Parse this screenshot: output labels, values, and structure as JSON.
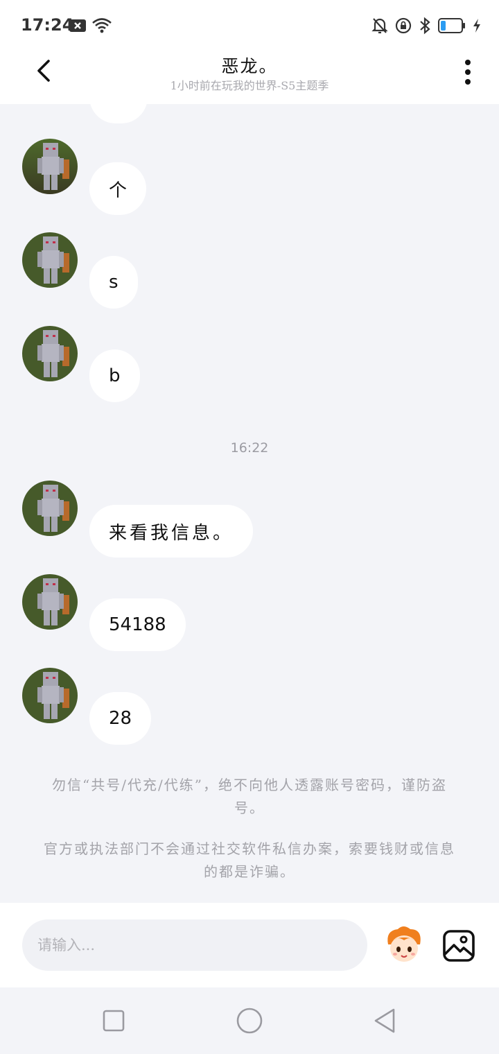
{
  "status_bar": {
    "time": "17:24",
    "left_icons": [
      "sim-x-icon",
      "wifi-icon"
    ],
    "right_icons": [
      "mute-bell-icon",
      "rotation-lock-icon",
      "bluetooth-icon",
      "battery-icon",
      "charging-icon"
    ],
    "battery_level": 0.25
  },
  "header": {
    "title": "恶龙。",
    "subtitle": "1小时前在玩我的世界-S5主题季"
  },
  "chat": {
    "messages": [
      {
        "text": "个"
      },
      {
        "text": "s"
      },
      {
        "text": "b"
      },
      {
        "timestamp": "16:22"
      },
      {
        "text": "来看我信息。"
      },
      {
        "text": "54188"
      },
      {
        "text": "28"
      }
    ],
    "notice_lines": [
      "勿信“共号/代充/代练”，绝不向他人透露账号密码，谨防盗号。",
      "官方或执法部门不会通过社交软件私信办案，索要钱财或信息的都是诈骗。"
    ]
  },
  "input": {
    "placeholder": "请输入..."
  },
  "colors": {
    "background": "#f3f4f8",
    "bubble": "#ffffff",
    "battery_fill": "#2b9cf2"
  }
}
